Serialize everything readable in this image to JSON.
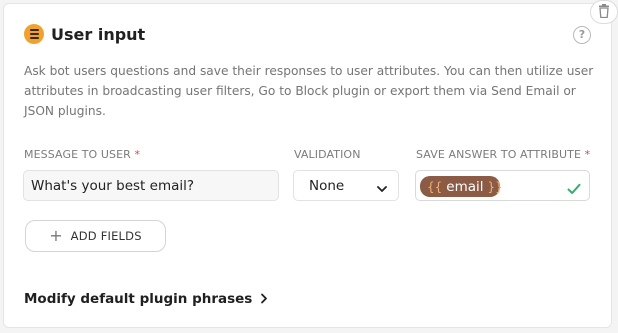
{
  "card": {
    "title": "User input",
    "plugin_icon": "list-lines-icon",
    "description": "Ask bot users questions and save their responses to user attributes. You can then utilize user attributes in broadcasting user filters, Go to Block plugin or export them via Send Email or JSON plugins.",
    "help_icon_glyph": "?"
  },
  "fields": {
    "message": {
      "label": "MESSAGE TO USER",
      "required_mark": "*",
      "value": "What's your best email?"
    },
    "validation": {
      "label": "VALIDATION",
      "value": "None"
    },
    "attribute": {
      "label": "SAVE ANSWER TO ATTRIBUTE",
      "required_mark": "*",
      "open_braces": "{{",
      "name": "email",
      "close_braces": "}}",
      "valid": true
    }
  },
  "actions": {
    "add_fields": {
      "plus": "+",
      "label": "ADD FIELDS"
    },
    "modify_phrases": {
      "label": "Modify default plugin phrases"
    }
  },
  "colors": {
    "plugin_icon_bg": "#f2a12e",
    "attribute_chip_bg": "#8b5b45",
    "attribute_braces": "#f0b271",
    "required": "#e04646",
    "valid_check": "#2fb26a"
  }
}
